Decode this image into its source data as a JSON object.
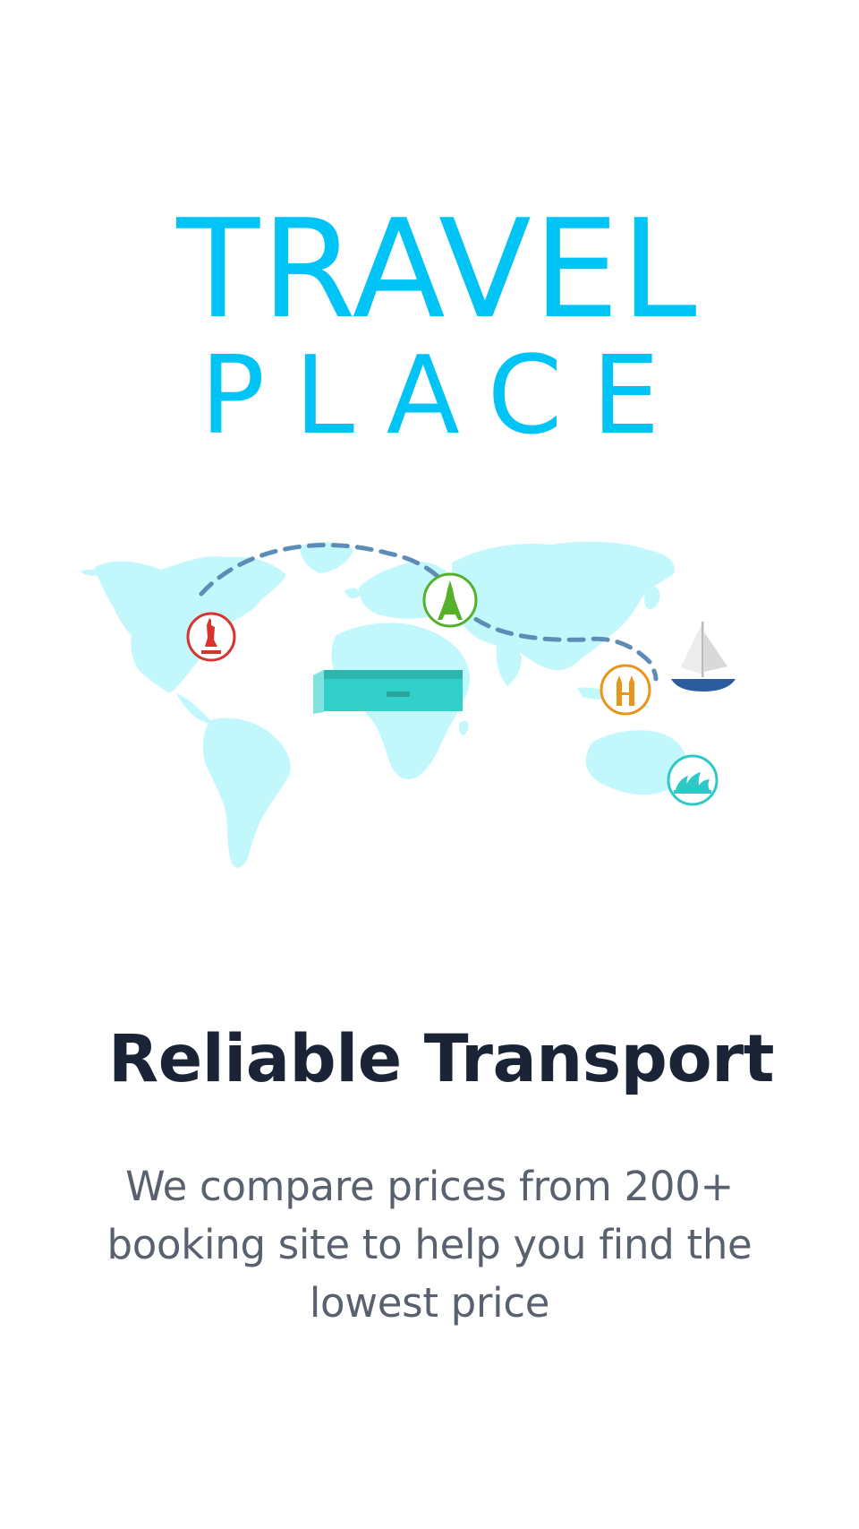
{
  "logo": {
    "line1": "TRAVEL",
    "line2": "PLACE",
    "color": "#00c4f5"
  },
  "illustration": {
    "map_color": "#c2f8fc",
    "route_color": "#5d8db7",
    "landmarks": [
      {
        "icon": "statue-of-liberty-icon",
        "color": "#d7332f"
      },
      {
        "icon": "eiffel-tower-icon",
        "color": "#56b02a"
      },
      {
        "icon": "petronas-towers-icon",
        "color": "#e8951a"
      },
      {
        "icon": "sydney-opera-house-icon",
        "color": "#2ec9c7"
      },
      {
        "icon": "sailboat-icon",
        "color": "#2b5b9f"
      },
      {
        "icon": "suitcase-icon",
        "color": "#33cfc9"
      }
    ]
  },
  "onboarding": {
    "headline": "Reliable Transport",
    "description": "We compare prices from 200+ booking site to help you find the lowest price",
    "headline_color": "#1a2436",
    "description_color": "#5a616e"
  }
}
